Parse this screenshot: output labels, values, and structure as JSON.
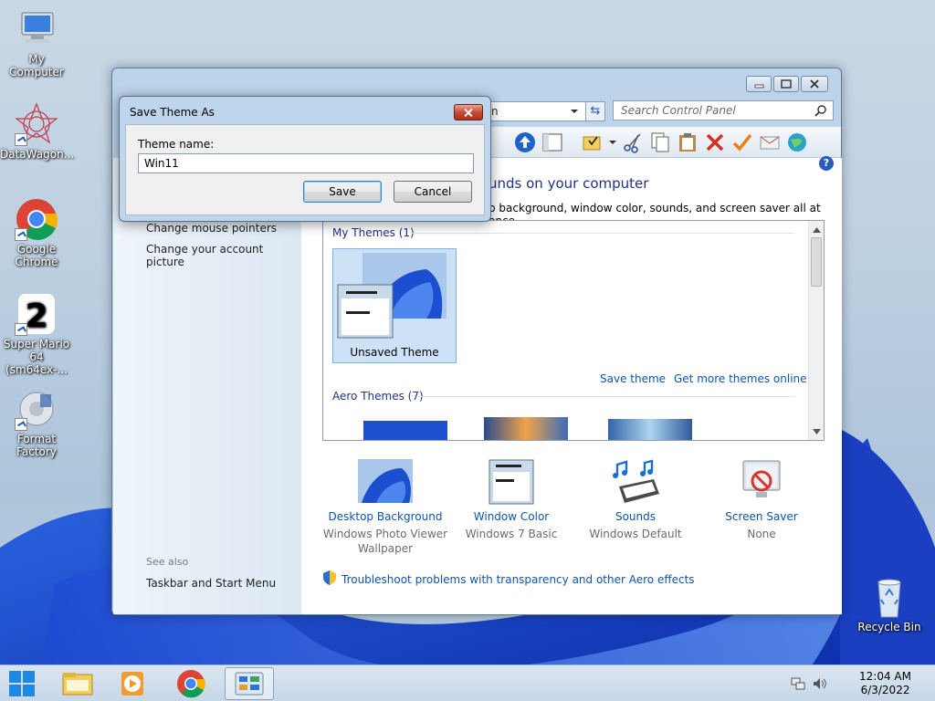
{
  "desktop": {
    "icons": [
      {
        "label": "My Computer"
      },
      {
        "label": "DataWagon..."
      },
      {
        "label": "Google Chrome"
      },
      {
        "label": "Super Mario 64 (sm64ex-..."
      },
      {
        "label": "Format Factory"
      },
      {
        "label": "Recycle Bin"
      }
    ]
  },
  "window": {
    "address_tail": "n",
    "search_placeholder": "Search Control Panel",
    "heading": "unds on your computer",
    "subtext": "p background, window color, sounds, and screen saver all at once.",
    "help_label": "?",
    "left_links": [
      "Change mouse pointers",
      "Change your account picture"
    ],
    "see_also_label": "See also",
    "see_also_links": [
      "Taskbar and Start Menu"
    ],
    "my_themes_label": "My Themes (1)",
    "unsaved_theme_label": "Unsaved Theme",
    "save_theme_link": "Save theme",
    "get_more_link": "Get more themes online",
    "aero_themes_label": "Aero Themes (7)",
    "bottom_items": [
      {
        "title": "Desktop Background",
        "sub": "Windows Photo Viewer Wallpaper"
      },
      {
        "title": "Window Color",
        "sub": "Windows 7 Basic"
      },
      {
        "title": "Sounds",
        "sub": "Windows Default"
      },
      {
        "title": "Screen Saver",
        "sub": "None"
      }
    ],
    "troubleshoot_link": "Troubleshoot problems with transparency and other Aero effects"
  },
  "dialog": {
    "title": "Save Theme As",
    "field_label": "Theme name:",
    "field_value": "Win11",
    "save_label": "Save",
    "cancel_label": "Cancel"
  },
  "taskbar": {
    "time": "12:04 AM",
    "date": "6/3/2022"
  },
  "colors": {
    "link": "#0d55a8",
    "heading": "#1e3287",
    "wallpaper_blue": "#1f4fd6"
  }
}
